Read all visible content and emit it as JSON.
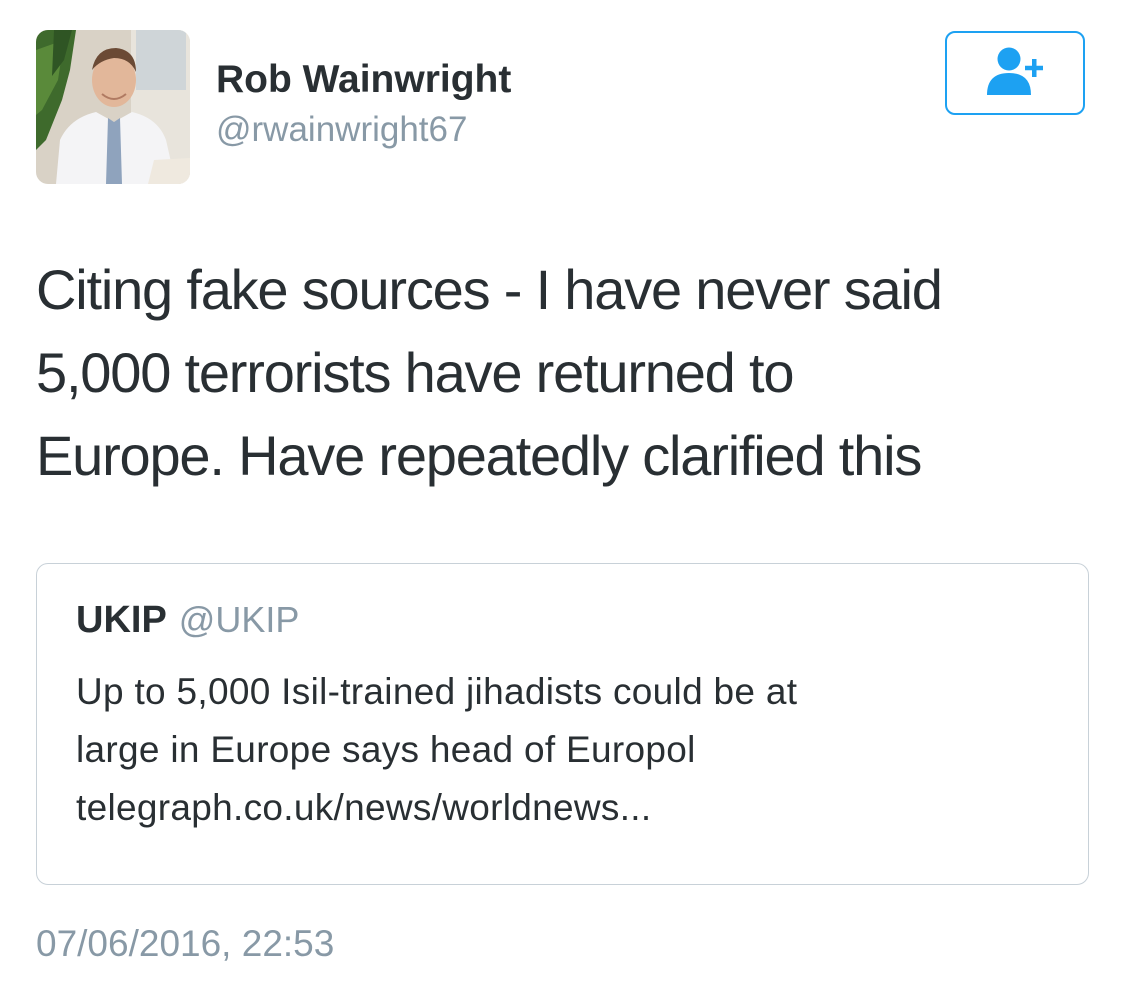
{
  "author": {
    "display_name": "Rob Wainwright",
    "handle": "@rwainwright67"
  },
  "follow_button": {
    "icon": "add-user-icon",
    "accent_color": "#1da1f2"
  },
  "tweet": {
    "text": "Citing fake sources - I have never said\n5,000 terrorists have returned to\nEurope. Have repeatedly clarified this",
    "timestamp": "07/06/2016, 22:53"
  },
  "quoted_tweet": {
    "display_name": "UKIP",
    "handle": "@UKIP",
    "text": "Up to 5,000 Isil-trained jihadists could be at\nlarge in Europe says head of Europol\ntelegraph.co.uk/news/worldnews..."
  },
  "colors": {
    "text_primary": "#292f33",
    "text_secondary": "#8899a6",
    "border": "#c8d1d8"
  }
}
